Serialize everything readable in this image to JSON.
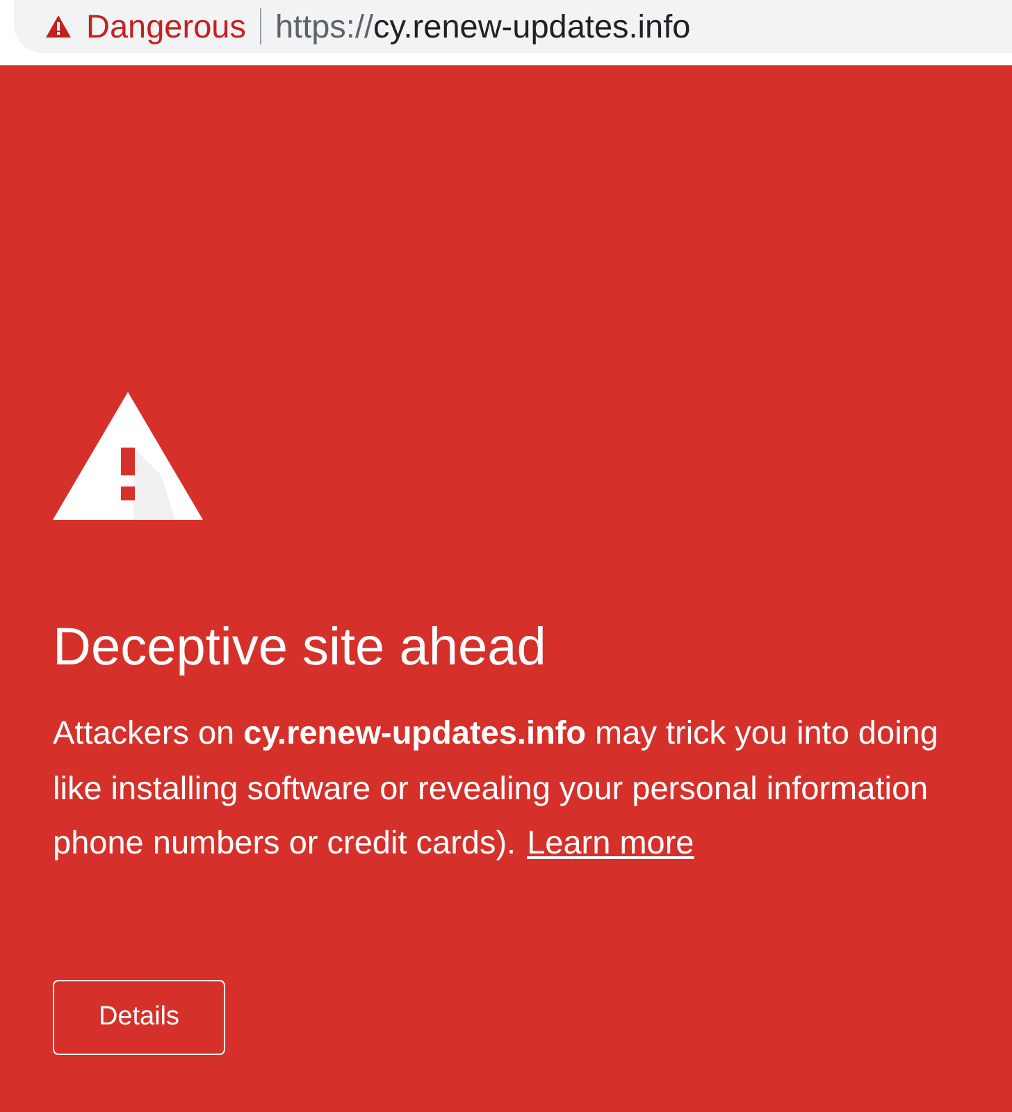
{
  "address_bar": {
    "security_label": "Dangerous",
    "url_scheme": "https://",
    "url_host": "cy.renew-updates.info"
  },
  "warning": {
    "title": "Deceptive site ahead",
    "lines": [
      "Attackers on **cy.renew-updates.info** may trick you into doing",
      "like installing software or revealing your personal information",
      "phone numbers or credit cards)."
    ],
    "link": "Learn more",
    "buttons": [
      "Details"
    ]
  }
}
